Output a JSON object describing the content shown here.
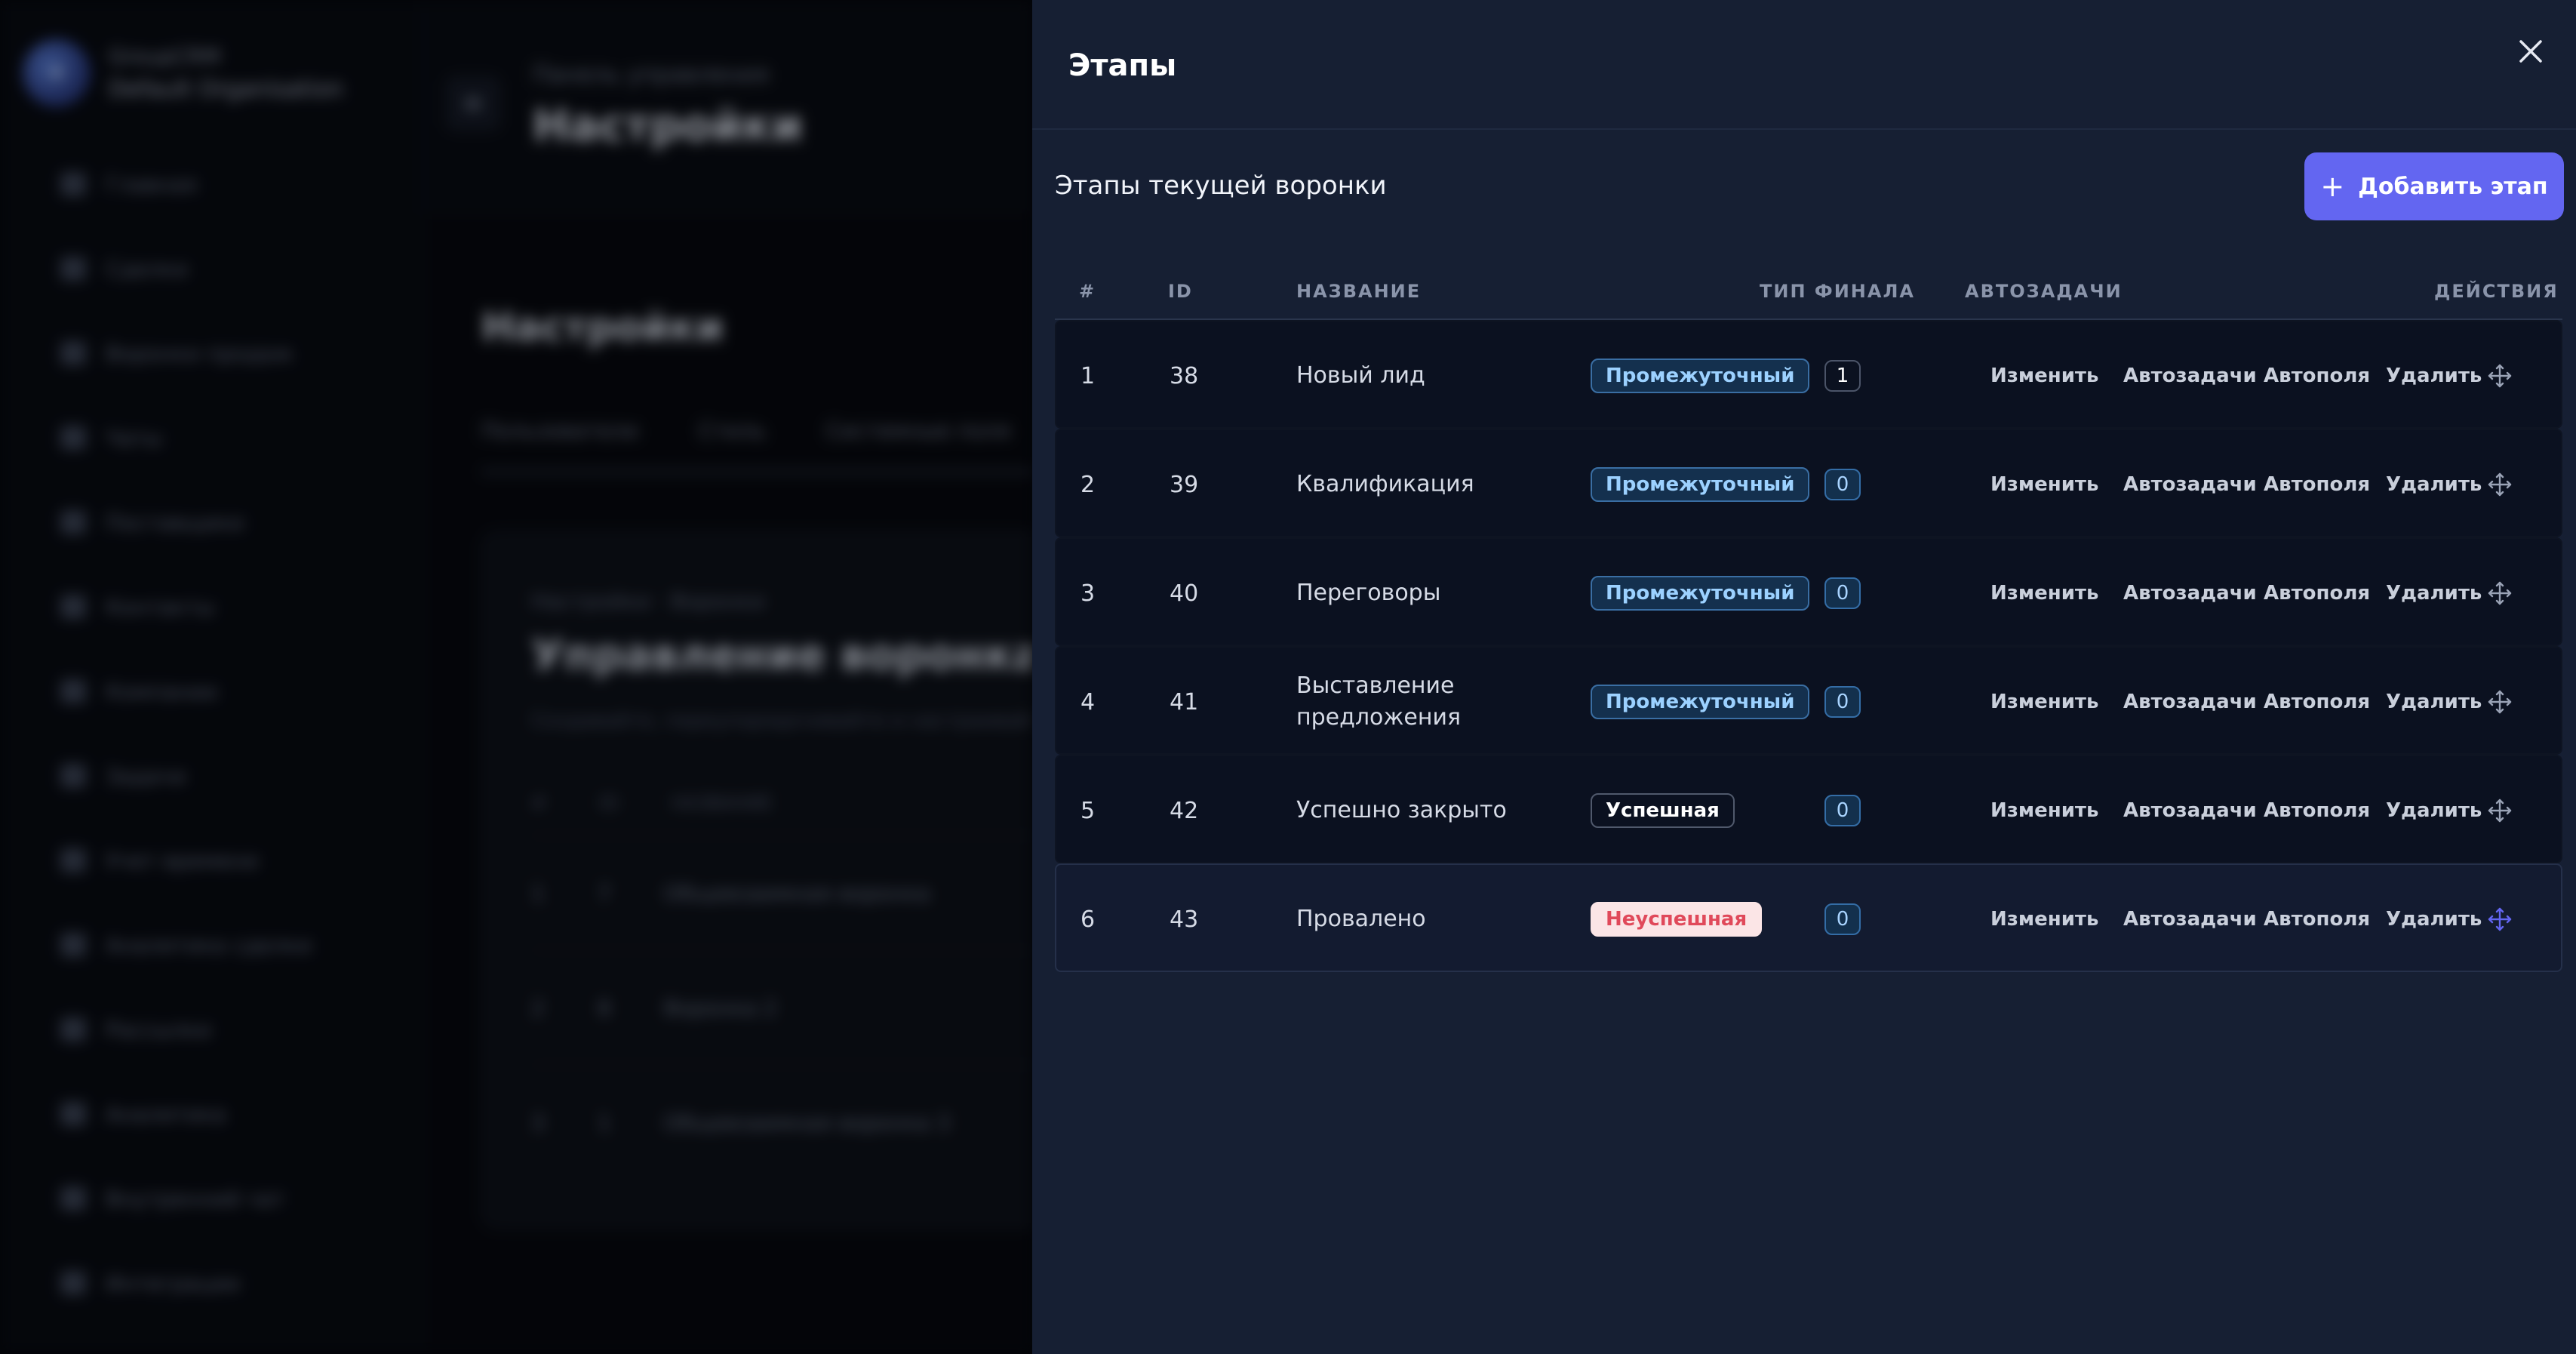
{
  "background": {
    "brand": {
      "name": "GroupCRM",
      "org": "Default Organisation"
    },
    "nav": [
      "Главная",
      "Сделки",
      "Воронки продаж",
      "Чаты",
      "Поставщики",
      "Контакты",
      "Компании",
      "Задачи",
      "Учет времени",
      "Аналитика сделки",
      "Рассылки",
      "Аналитика",
      "Внутренний чат",
      "Интеграции"
    ],
    "crumb": "Панель управления",
    "page_title": "Настройки",
    "section_title": "Настройки",
    "tabs": [
      "Пользователи",
      "Стиль",
      "Системные поля"
    ],
    "card": {
      "crumb": "Настройки · Воронки",
      "title": "Управление воронками",
      "subtitle": "Создавайте, переупорядочивайте и настраивайте воронки",
      "head": [
        "#",
        "ID",
        "НАЗВАНИЕ"
      ],
      "rows": [
        [
          "1",
          "7",
          "Общевзаимная воронка"
        ],
        [
          "2",
          "8",
          "Воронка 2"
        ],
        [
          "3",
          "1",
          "Общевзаимная воронка 3"
        ]
      ]
    }
  },
  "drawer": {
    "title": "Этапы",
    "section_title": "Этапы текущей воронки",
    "add_button": "Добавить этап",
    "columns": {
      "num": "#",
      "id": "ID",
      "name": "НАЗВАНИЕ",
      "final_type": "ТИП ФИНАЛА",
      "autotasks": "АВТОЗАДАЧИ",
      "actions": "ДЕЙСТВИЯ"
    },
    "action_labels": {
      "edit": "Изменить",
      "autotasks": "Автозадачи",
      "autofields": "Автополя",
      "delete": "Удалить"
    },
    "rows": [
      {
        "num": "1",
        "id": "38",
        "name": "Новый лид",
        "type": "Промежуточный",
        "count": "1"
      },
      {
        "num": "2",
        "id": "39",
        "name": "Квалификация",
        "type": "Промежуточный",
        "count": "0"
      },
      {
        "num": "3",
        "id": "40",
        "name": "Переговоры",
        "type": "Промежуточный",
        "count": "0"
      },
      {
        "num": "4",
        "id": "41",
        "name": "Выставление предложения",
        "type": "Промежуточный",
        "count": "0"
      },
      {
        "num": "5",
        "id": "42",
        "name": "Успешно закрыто",
        "type": "Успешная",
        "count": "0"
      },
      {
        "num": "6",
        "id": "43",
        "name": "Провалено",
        "type": "Неуспешная",
        "count": "0"
      }
    ],
    "colors": {
      "panel_bg": "#161f33",
      "row_bg": "#0b1120",
      "accent": "#6366f1",
      "badge_mid": "#9cd1ff",
      "badge_fail_bg": "#fbe5e6",
      "badge_fail_text": "#e0495a",
      "drag_active": "#6366f1"
    }
  }
}
